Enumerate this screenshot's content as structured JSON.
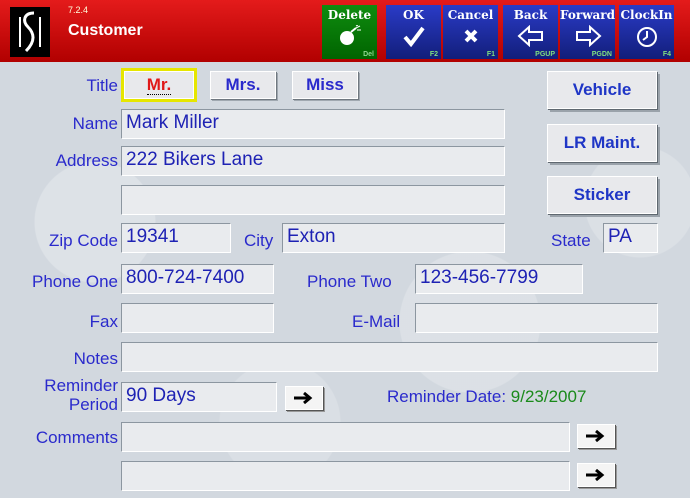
{
  "app": {
    "version": "7.2.4",
    "title": "Customer"
  },
  "toolbar": {
    "delete": {
      "label": "Delete",
      "hotkey": "Del",
      "icon": "bomb-icon"
    },
    "ok": {
      "label": "OK",
      "hotkey": "F2",
      "icon": "checkmark-icon"
    },
    "cancel": {
      "label": "Cancel",
      "hotkey": "F1",
      "icon": "x-icon"
    },
    "back": {
      "label": "Back",
      "hotkey": "PGUP",
      "icon": "arrow-left-icon"
    },
    "forward": {
      "label": "Forward",
      "hotkey": "PGDN",
      "icon": "arrow-right-icon"
    },
    "clockin": {
      "label": "ClockIn",
      "hotkey": "F4",
      "icon": "clock-icon"
    }
  },
  "title_field": {
    "label": "Title",
    "options": [
      "Mr.",
      "Mrs.",
      "Miss"
    ],
    "selected": "Mr."
  },
  "side_buttons": {
    "vehicle": "Vehicle",
    "lr_maint": "LR Maint.",
    "sticker": "Sticker"
  },
  "fields": {
    "name": {
      "label": "Name",
      "value": "Mark Miller"
    },
    "address": {
      "label": "Address",
      "value": "222 Bikers Lane"
    },
    "address2": {
      "value": ""
    },
    "zip": {
      "label": "Zip Code",
      "value": "19341"
    },
    "city": {
      "label": "City",
      "value": "Exton"
    },
    "state": {
      "label": "State",
      "value": "PA"
    },
    "phone_one": {
      "label": "Phone One",
      "value": "800-724-7400"
    },
    "phone_two": {
      "label": "Phone Two",
      "value": "123-456-7799"
    },
    "fax": {
      "label": "Fax",
      "value": ""
    },
    "email": {
      "label": "E-Mail",
      "value": ""
    },
    "notes": {
      "label": "Notes",
      "value": ""
    },
    "reminder_period": {
      "label_line1": "Reminder",
      "label_line2": "Period",
      "value": "90 Days"
    },
    "reminder_date": {
      "label": "Reminder Date:",
      "value": "9/23/2007"
    },
    "comments": {
      "label": "Comments",
      "value1": "",
      "value2": ""
    }
  },
  "colors": {
    "titlebar": "#cc0000",
    "label": "#2a2acc",
    "reminder_date": "#1a8a1a",
    "selected_outline": "#e6e600"
  }
}
